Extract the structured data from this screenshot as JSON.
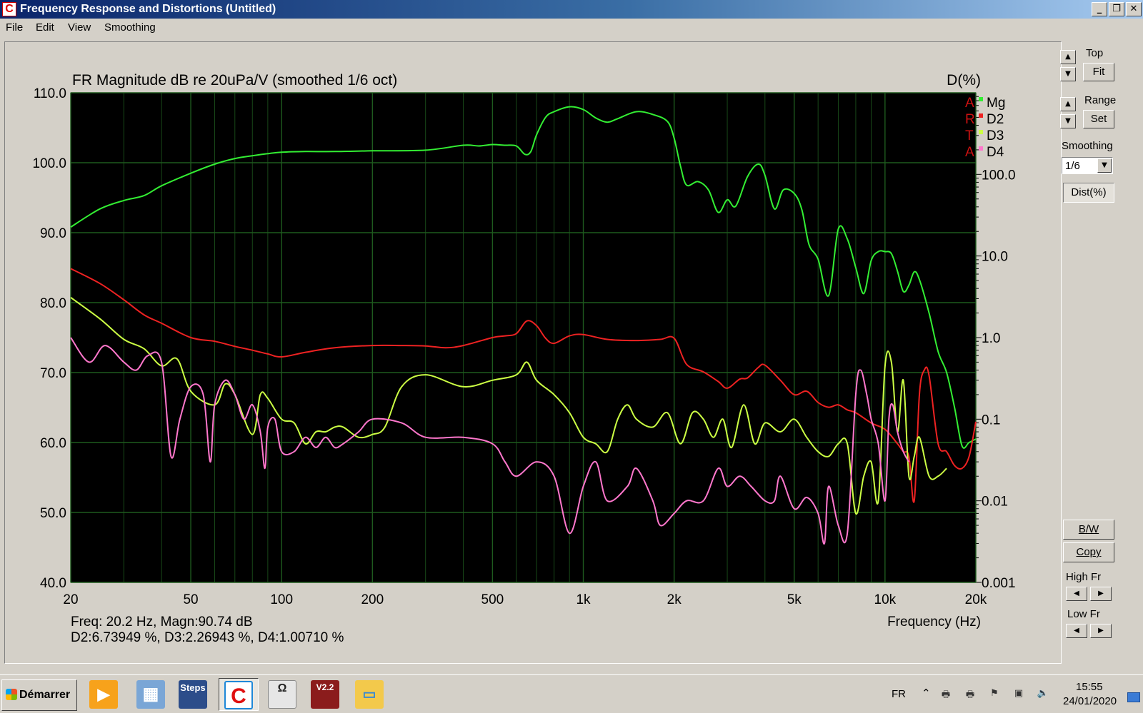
{
  "window": {
    "title": "Frequency Response and Distortions (Untitled)",
    "controls": [
      "_",
      "❐",
      "✕"
    ]
  },
  "menu": [
    "File",
    "Edit",
    "View",
    "Smoothing"
  ],
  "plot": {
    "title": "FR Magnitude dB re 20uPa/V (smoothed 1/6 oct)",
    "right_axis_title": "D(%)",
    "x_label": "Frequency (Hz)",
    "readout_line1": "Freq: 20.2 Hz, Magn:90.74 dB",
    "readout_line2": "D2:6.73949 %, D3:2.26943 %, D4:1.00710 %",
    "legend_side_letters": [
      "A",
      "R",
      "T",
      "A"
    ],
    "legend": [
      {
        "name": "Mg",
        "color": "#33ee33"
      },
      {
        "name": "D2",
        "color": "#ee2222"
      },
      {
        "name": "D3",
        "color": "#ccff44"
      },
      {
        "name": "D4",
        "color": "#ff77cc"
      }
    ]
  },
  "chart_data": {
    "type": "line",
    "x_scale": "log",
    "xlim": [
      20,
      20000
    ],
    "ylim": [
      40,
      110
    ],
    "y2_scale": "log",
    "y2lim": [
      0.001,
      1000
    ],
    "background": "#000000",
    "grid": true,
    "grid_color": "#1e5a1e",
    "x_ticks": [
      20,
      50,
      100,
      200,
      500,
      1000,
      2000,
      5000,
      10000,
      20000
    ],
    "x_tick_labels": [
      "20",
      "50",
      "100",
      "200",
      "500",
      "1k",
      "2k",
      "5k",
      "10k",
      "20k"
    ],
    "y_ticks": [
      110,
      100,
      90,
      80,
      70,
      60,
      50,
      40
    ],
    "y_tick_labels": [
      "110.0",
      "100.0",
      "90.0",
      "80.0",
      "70.0",
      "60.0",
      "50.0",
      "40.0"
    ],
    "y2_ticks": [
      100,
      10,
      1,
      0.1,
      0.01,
      0.001
    ],
    "y2_tick_labels": [
      "100.0",
      "10.0",
      "1.0",
      "0.1",
      "0.01",
      "0.001"
    ],
    "series": [
      {
        "name": "Mg",
        "color": "#33ee33",
        "axis": "left",
        "x": [
          20,
          25,
          30,
          35,
          40,
          50,
          60,
          70,
          80,
          90,
          100,
          120,
          150,
          200,
          300,
          400,
          450,
          500,
          550,
          600,
          640,
          670,
          700,
          750,
          800,
          900,
          1000,
          1100,
          1200,
          1300,
          1500,
          1700,
          1900,
          2000,
          2100,
          2200,
          2400,
          2600,
          2800,
          3000,
          3200,
          3500,
          3800,
          4000,
          4300,
          4600,
          5000,
          5300,
          5600,
          6000,
          6500,
          7000,
          7500,
          8000,
          8500,
          9000,
          9500,
          10000,
          10500,
          11000,
          11500,
          12000,
          12500,
          13000,
          14000,
          15000,
          16000,
          17000,
          18000,
          19000,
          20000
        ],
        "values": [
          90.8,
          93.4,
          94.6,
          95.3,
          96.7,
          98.5,
          99.8,
          100.6,
          101.0,
          101.3,
          101.5,
          101.6,
          101.6,
          101.7,
          101.8,
          102.5,
          102.4,
          102.6,
          102.5,
          102.4,
          101.2,
          101.6,
          104.0,
          106.5,
          107.3,
          108.0,
          107.6,
          106.4,
          105.8,
          106.3,
          107.3,
          106.9,
          105.9,
          103.5,
          99.5,
          96.8,
          97.3,
          96.1,
          92.9,
          94.7,
          93.8,
          98.0,
          99.8,
          98.2,
          93.4,
          96.1,
          95.6,
          93.3,
          88.3,
          86.2,
          81.0,
          90.5,
          89.1,
          85.0,
          81.3,
          86.0,
          87.3,
          87.3,
          87.0,
          84.5,
          81.6,
          82.5,
          84.4,
          83.3,
          78.5,
          73.0,
          70.0,
          65.0,
          59.5,
          60.0,
          60.5
        ]
      },
      {
        "name": "D2",
        "color": "#ee2222",
        "axis": "right",
        "x": [
          20,
          25,
          30,
          35,
          40,
          50,
          60,
          70,
          80,
          90,
          100,
          120,
          150,
          200,
          250,
          300,
          350,
          400,
          500,
          550,
          600,
          650,
          700,
          750,
          800,
          900,
          1000,
          1200,
          1500,
          1800,
          2000,
          2200,
          2500,
          2800,
          3000,
          3300,
          3500,
          3800,
          4000,
          4500,
          5000,
          5500,
          6000,
          6500,
          7000,
          7500,
          8000,
          9000,
          10000,
          11000,
          11500,
          12000,
          12500,
          13000,
          13500,
          14000,
          15000,
          16000,
          17000,
          18000,
          19000,
          20000
        ],
        "values": [
          7.0,
          4.6,
          2.9,
          1.9,
          1.5,
          1.0,
          0.9,
          0.78,
          0.7,
          0.63,
          0.58,
          0.66,
          0.75,
          0.8,
          0.8,
          0.79,
          0.75,
          0.8,
          1.0,
          1.05,
          1.12,
          1.6,
          1.4,
          0.98,
          0.85,
          1.05,
          1.09,
          0.95,
          0.92,
          0.95,
          0.98,
          0.47,
          0.38,
          0.29,
          0.24,
          0.31,
          0.32,
          0.43,
          0.46,
          0.3,
          0.2,
          0.22,
          0.16,
          0.14,
          0.15,
          0.13,
          0.12,
          0.09,
          0.075,
          0.05,
          0.04,
          0.035,
          0.01,
          0.2,
          0.4,
          0.34,
          0.05,
          0.04,
          0.027,
          0.025,
          0.035,
          0.093
        ]
      },
      {
        "name": "D3",
        "color": "#ccff44",
        "axis": "right",
        "x": [
          20,
          25,
          30,
          35,
          40,
          45,
          50,
          60,
          65,
          70,
          80,
          85,
          90,
          100,
          110,
          120,
          130,
          140,
          150,
          160,
          180,
          200,
          220,
          250,
          300,
          400,
          500,
          600,
          650,
          700,
          800,
          900,
          1000,
          1100,
          1200,
          1300,
          1400,
          1500,
          1700,
          1900,
          2100,
          2300,
          2500,
          2700,
          2900,
          3100,
          3400,
          3700,
          4000,
          4500,
          5000,
          5500,
          6000,
          6500,
          7000,
          7500,
          8000,
          8500,
          9000,
          9500,
          10000,
          10500,
          11000,
          11500,
          12000,
          12500,
          13000,
          14000,
          15000,
          16000
        ],
        "values": [
          3.1,
          1.7,
          0.95,
          0.73,
          0.45,
          0.55,
          0.22,
          0.15,
          0.27,
          0.2,
          0.065,
          0.2,
          0.18,
          0.1,
          0.09,
          0.05,
          0.07,
          0.07,
          0.08,
          0.08,
          0.06,
          0.065,
          0.08,
          0.25,
          0.35,
          0.25,
          0.3,
          0.35,
          0.5,
          0.3,
          0.2,
          0.12,
          0.06,
          0.05,
          0.04,
          0.1,
          0.15,
          0.1,
          0.08,
          0.12,
          0.05,
          0.12,
          0.1,
          0.06,
          0.1,
          0.045,
          0.15,
          0.05,
          0.09,
          0.07,
          0.1,
          0.06,
          0.04,
          0.035,
          0.05,
          0.05,
          0.007,
          0.02,
          0.03,
          0.01,
          0.45,
          0.5,
          0.07,
          0.3,
          0.02,
          0.035,
          0.06,
          0.02,
          0.02,
          0.025
        ]
      },
      {
        "name": "D4",
        "color": "#ff77cc",
        "axis": "right",
        "x": [
          20,
          23,
          26,
          30,
          33,
          36,
          40,
          43,
          46,
          50,
          55,
          58,
          60,
          65,
          70,
          75,
          80,
          85,
          88,
          90,
          95,
          100,
          110,
          120,
          130,
          140,
          150,
          160,
          180,
          200,
          250,
          300,
          400,
          500,
          550,
          600,
          700,
          800,
          900,
          1000,
          1100,
          1200,
          1400,
          1500,
          1700,
          1800,
          2000,
          2200,
          2500,
          2800,
          3000,
          3300,
          3600,
          4000,
          4300,
          4500,
          5000,
          5500,
          6000,
          6300,
          6500,
          7000,
          7500,
          8000,
          8300,
          8700,
          9000,
          9500,
          10000,
          10300,
          10600,
          11000,
          11500,
          12000
        ],
        "values": [
          1.0,
          0.5,
          0.8,
          0.5,
          0.4,
          0.6,
          0.5,
          0.035,
          0.1,
          0.25,
          0.2,
          0.03,
          0.15,
          0.3,
          0.2,
          0.1,
          0.15,
          0.07,
          0.025,
          0.08,
          0.1,
          0.04,
          0.04,
          0.06,
          0.045,
          0.06,
          0.045,
          0.05,
          0.07,
          0.1,
          0.09,
          0.06,
          0.06,
          0.05,
          0.03,
          0.02,
          0.03,
          0.02,
          0.004,
          0.015,
          0.03,
          0.01,
          0.015,
          0.025,
          0.01,
          0.005,
          0.007,
          0.01,
          0.01,
          0.025,
          0.015,
          0.02,
          0.015,
          0.01,
          0.01,
          0.02,
          0.008,
          0.011,
          0.007,
          0.003,
          0.015,
          0.005,
          0.004,
          0.2,
          0.4,
          0.2,
          0.1,
          0.05,
          0.01,
          0.1,
          0.15,
          0.07,
          0.04,
          0.03
        ]
      }
    ]
  },
  "sidepanel": {
    "top_label": "Top",
    "fit_label": "Fit",
    "range_label": "Range",
    "set_label": "Set",
    "smoothing_label": "Smoothing",
    "smoothing_value": "1/6",
    "dist_label": "Dist(%)",
    "bw_label": "B/W",
    "copy_label": "Copy",
    "highfr_label": "High Fr",
    "lowfr_label": "Low Fr"
  },
  "taskbar": {
    "start_label": "Démarrer",
    "apps": [
      {
        "icon": "media-player-icon",
        "text": "▶",
        "bg": "#f7a21b"
      },
      {
        "icon": "calculator-icon",
        "text": "▦",
        "bg": "#7aa6d6"
      },
      {
        "icon": "steps-icon",
        "text": "Steps",
        "bg": "#2c4d8a"
      },
      {
        "icon": "arta-icon",
        "text": "C",
        "bg": "#ffffff"
      },
      {
        "icon": "limp-icon",
        "text": "Ω",
        "bg": "#e6e6e6"
      },
      {
        "icon": "video-icon",
        "text": "V2.2",
        "bg": "#8b1c1c"
      },
      {
        "icon": "folder-icon",
        "text": "▭",
        "bg": "#f3c94b"
      }
    ],
    "language": "FR",
    "tray_chevron": "⌃",
    "clock_time": "15:55",
    "clock_date": "24/01/2020"
  }
}
